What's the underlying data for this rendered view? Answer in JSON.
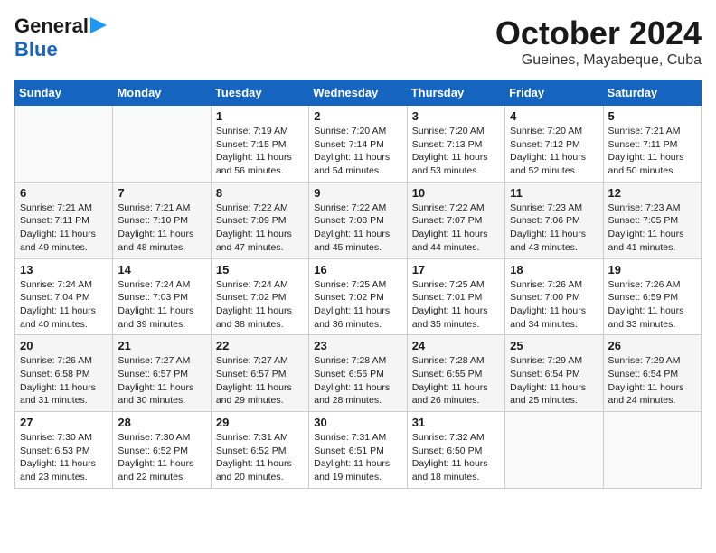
{
  "header": {
    "logo_line1": "General",
    "logo_line2": "Blue",
    "month": "October 2024",
    "location": "Gueines, Mayabeque, Cuba"
  },
  "days_of_week": [
    "Sunday",
    "Monday",
    "Tuesday",
    "Wednesday",
    "Thursday",
    "Friday",
    "Saturday"
  ],
  "weeks": [
    [
      {
        "day": "",
        "info": ""
      },
      {
        "day": "",
        "info": ""
      },
      {
        "day": "1",
        "info": "Sunrise: 7:19 AM\nSunset: 7:15 PM\nDaylight: 11 hours and 56 minutes."
      },
      {
        "day": "2",
        "info": "Sunrise: 7:20 AM\nSunset: 7:14 PM\nDaylight: 11 hours and 54 minutes."
      },
      {
        "day": "3",
        "info": "Sunrise: 7:20 AM\nSunset: 7:13 PM\nDaylight: 11 hours and 53 minutes."
      },
      {
        "day": "4",
        "info": "Sunrise: 7:20 AM\nSunset: 7:12 PM\nDaylight: 11 hours and 52 minutes."
      },
      {
        "day": "5",
        "info": "Sunrise: 7:21 AM\nSunset: 7:11 PM\nDaylight: 11 hours and 50 minutes."
      }
    ],
    [
      {
        "day": "6",
        "info": "Sunrise: 7:21 AM\nSunset: 7:11 PM\nDaylight: 11 hours and 49 minutes."
      },
      {
        "day": "7",
        "info": "Sunrise: 7:21 AM\nSunset: 7:10 PM\nDaylight: 11 hours and 48 minutes."
      },
      {
        "day": "8",
        "info": "Sunrise: 7:22 AM\nSunset: 7:09 PM\nDaylight: 11 hours and 47 minutes."
      },
      {
        "day": "9",
        "info": "Sunrise: 7:22 AM\nSunset: 7:08 PM\nDaylight: 11 hours and 45 minutes."
      },
      {
        "day": "10",
        "info": "Sunrise: 7:22 AM\nSunset: 7:07 PM\nDaylight: 11 hours and 44 minutes."
      },
      {
        "day": "11",
        "info": "Sunrise: 7:23 AM\nSunset: 7:06 PM\nDaylight: 11 hours and 43 minutes."
      },
      {
        "day": "12",
        "info": "Sunrise: 7:23 AM\nSunset: 7:05 PM\nDaylight: 11 hours and 41 minutes."
      }
    ],
    [
      {
        "day": "13",
        "info": "Sunrise: 7:24 AM\nSunset: 7:04 PM\nDaylight: 11 hours and 40 minutes."
      },
      {
        "day": "14",
        "info": "Sunrise: 7:24 AM\nSunset: 7:03 PM\nDaylight: 11 hours and 39 minutes."
      },
      {
        "day": "15",
        "info": "Sunrise: 7:24 AM\nSunset: 7:02 PM\nDaylight: 11 hours and 38 minutes."
      },
      {
        "day": "16",
        "info": "Sunrise: 7:25 AM\nSunset: 7:02 PM\nDaylight: 11 hours and 36 minutes."
      },
      {
        "day": "17",
        "info": "Sunrise: 7:25 AM\nSunset: 7:01 PM\nDaylight: 11 hours and 35 minutes."
      },
      {
        "day": "18",
        "info": "Sunrise: 7:26 AM\nSunset: 7:00 PM\nDaylight: 11 hours and 34 minutes."
      },
      {
        "day": "19",
        "info": "Sunrise: 7:26 AM\nSunset: 6:59 PM\nDaylight: 11 hours and 33 minutes."
      }
    ],
    [
      {
        "day": "20",
        "info": "Sunrise: 7:26 AM\nSunset: 6:58 PM\nDaylight: 11 hours and 31 minutes."
      },
      {
        "day": "21",
        "info": "Sunrise: 7:27 AM\nSunset: 6:57 PM\nDaylight: 11 hours and 30 minutes."
      },
      {
        "day": "22",
        "info": "Sunrise: 7:27 AM\nSunset: 6:57 PM\nDaylight: 11 hours and 29 minutes."
      },
      {
        "day": "23",
        "info": "Sunrise: 7:28 AM\nSunset: 6:56 PM\nDaylight: 11 hours and 28 minutes."
      },
      {
        "day": "24",
        "info": "Sunrise: 7:28 AM\nSunset: 6:55 PM\nDaylight: 11 hours and 26 minutes."
      },
      {
        "day": "25",
        "info": "Sunrise: 7:29 AM\nSunset: 6:54 PM\nDaylight: 11 hours and 25 minutes."
      },
      {
        "day": "26",
        "info": "Sunrise: 7:29 AM\nSunset: 6:54 PM\nDaylight: 11 hours and 24 minutes."
      }
    ],
    [
      {
        "day": "27",
        "info": "Sunrise: 7:30 AM\nSunset: 6:53 PM\nDaylight: 11 hours and 23 minutes."
      },
      {
        "day": "28",
        "info": "Sunrise: 7:30 AM\nSunset: 6:52 PM\nDaylight: 11 hours and 22 minutes."
      },
      {
        "day": "29",
        "info": "Sunrise: 7:31 AM\nSunset: 6:52 PM\nDaylight: 11 hours and 20 minutes."
      },
      {
        "day": "30",
        "info": "Sunrise: 7:31 AM\nSunset: 6:51 PM\nDaylight: 11 hours and 19 minutes."
      },
      {
        "day": "31",
        "info": "Sunrise: 7:32 AM\nSunset: 6:50 PM\nDaylight: 11 hours and 18 minutes."
      },
      {
        "day": "",
        "info": ""
      },
      {
        "day": "",
        "info": ""
      }
    ]
  ]
}
